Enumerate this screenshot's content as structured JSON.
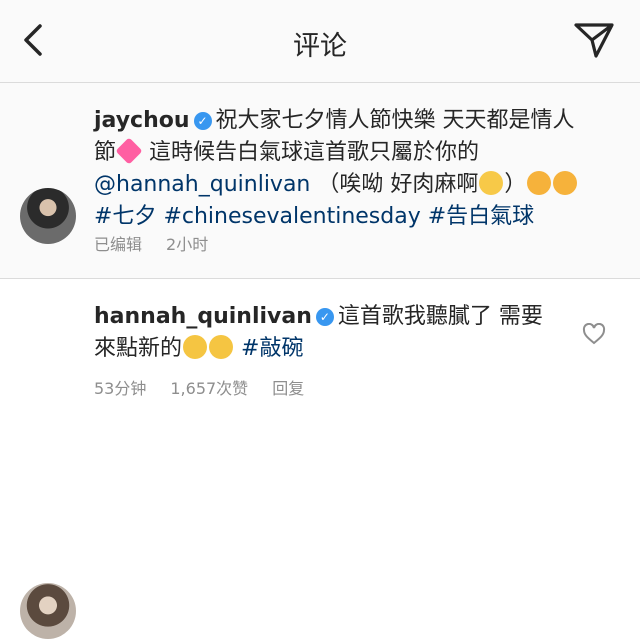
{
  "header": {
    "title": "评论"
  },
  "caption": {
    "username": "jaychou",
    "text_1": "祝大家七夕情人節快樂 天天都是情人節",
    "text_2": "這時候告白氣球這首歌只屬於你的",
    "mention": "@hannah_quinlivan",
    "text_3": "（唉呦 好肉麻啊",
    "text_4": "）",
    "hashtag_1": "#七夕",
    "hashtag_2": "#chinesevalentinesday",
    "hashtag_3": "#告白氣球",
    "meta_edited": "已编辑",
    "meta_time": "2小时"
  },
  "comment": {
    "username": "hannah_quinlivan",
    "text": "這首歌我聽膩了 需要來點新的",
    "hashtag": "#敲碗",
    "time": "53分钟",
    "likes": "1,657次赞",
    "reply": "回复"
  },
  "colors": {
    "link": "#003569",
    "verified": "#3897f0",
    "meta": "#8e8e8e"
  }
}
